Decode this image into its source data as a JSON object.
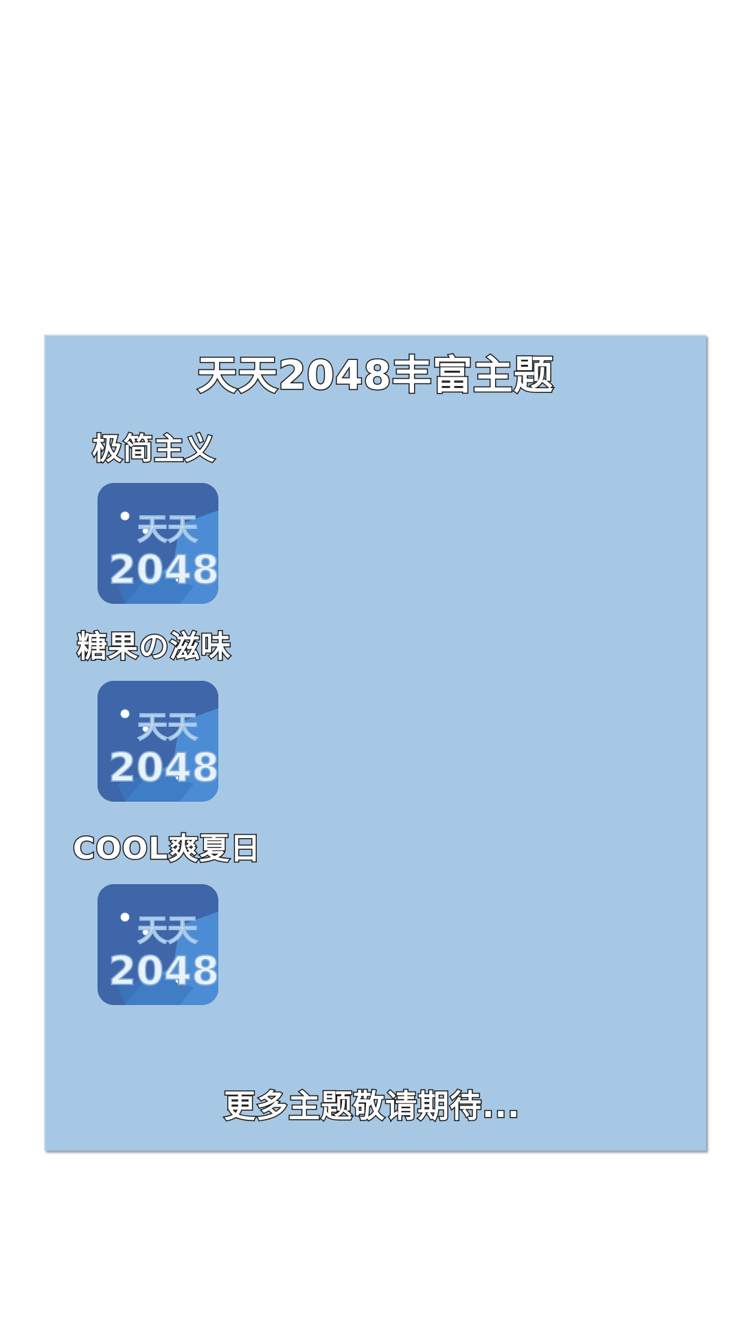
{
  "panel": {
    "title": "天天2048丰富主题",
    "footer": "更多主题敬请期待..."
  },
  "themes": [
    {
      "label": "极简主义",
      "icon": "tiantian-2048-snow-icon",
      "icon_text_top": "天天",
      "icon_text_bottom": "2048"
    },
    {
      "label": "糖果の滋味",
      "icon": "tiantian-2048-snow-icon",
      "icon_text_top": "天天",
      "icon_text_bottom": "2048"
    },
    {
      "label": "COOL爽夏日",
      "icon": "tiantian-2048-snow-icon",
      "icon_text_top": "天天",
      "icon_text_bottom": "2048"
    }
  ],
  "colors": {
    "panel_bg": "#a7c8e4",
    "icon_bg": "#3f66a8",
    "icon_accent": "#4f93dc",
    "text_fill": "#ffffff",
    "text_stroke": "#1a1a1a"
  }
}
